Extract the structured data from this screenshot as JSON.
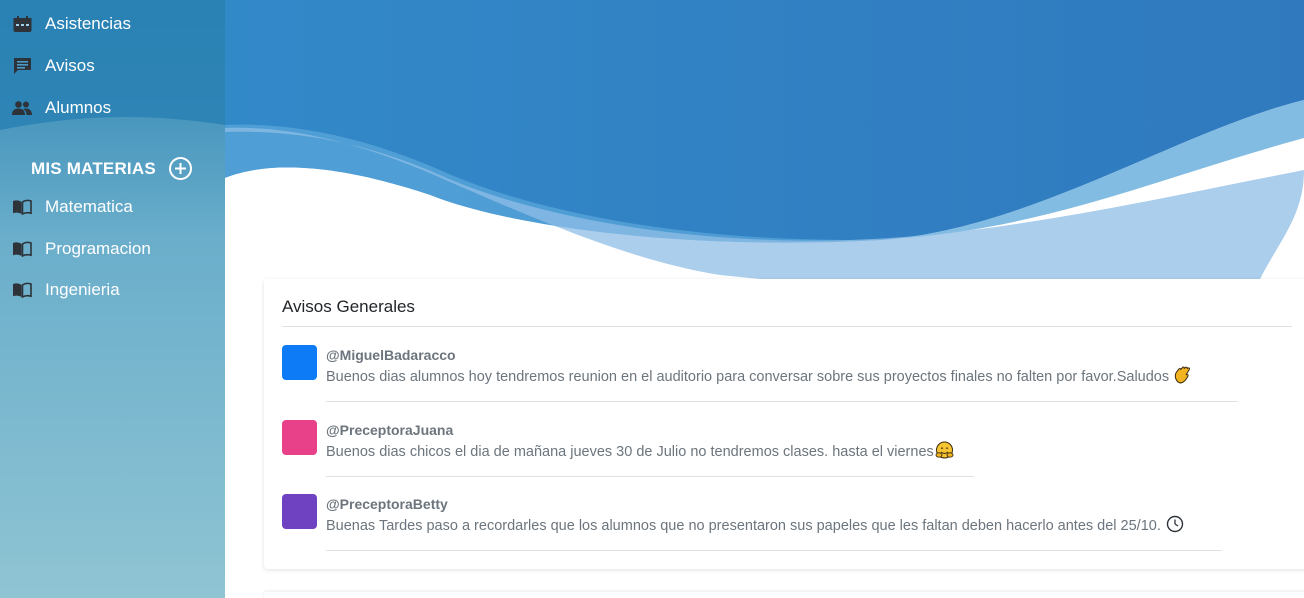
{
  "sidebar": {
    "nav": [
      {
        "label": "Asistencias",
        "icon": "calendar-icon"
      },
      {
        "label": "Avisos",
        "icon": "message-icon"
      },
      {
        "label": "Alumnos",
        "icon": "people-icon"
      }
    ],
    "section_title": "MIS MATERIAS",
    "add_icon": "plus-circle-icon",
    "materias": [
      {
        "label": "Matematica",
        "icon": "book-icon"
      },
      {
        "label": "Programacion",
        "icon": "book-icon"
      },
      {
        "label": "Ingenieria",
        "icon": "book-icon"
      }
    ]
  },
  "main": {
    "card_title": "Avisos Generales",
    "notices": [
      {
        "user": "@MiguelBadaracco",
        "message": "Buenos dias alumnos hoy tendremos reunion en el auditorio para conversar sobre sus proyectos finales no falten por favor.Saludos",
        "emoji": "waving-hand-emoji",
        "avatar_color": "#0d7bf5"
      },
      {
        "user": "@PreceptoraJuana",
        "message": "Buenos dias chicos el dia de mañana jueves 30 de Julio no tendremos clases. hasta el viernes",
        "emoji": "hugging-face-emoji",
        "avatar_color": "#e8418a"
      },
      {
        "user": "@PreceptoraBetty",
        "message": "Buenas Tardes paso a recordarles que los alumnos que no presentaron sus papeles que les faltan deben hacerlo antes del 25/10.",
        "emoji": "clock-emoji",
        "avatar_color": "#6f42c1"
      }
    ]
  },
  "colors": {
    "sidebar_top": "#2a83b6",
    "sidebar_bottom": "#8cc3d3",
    "header_blue": "#2f86c5",
    "text_muted": "#6c757d"
  }
}
